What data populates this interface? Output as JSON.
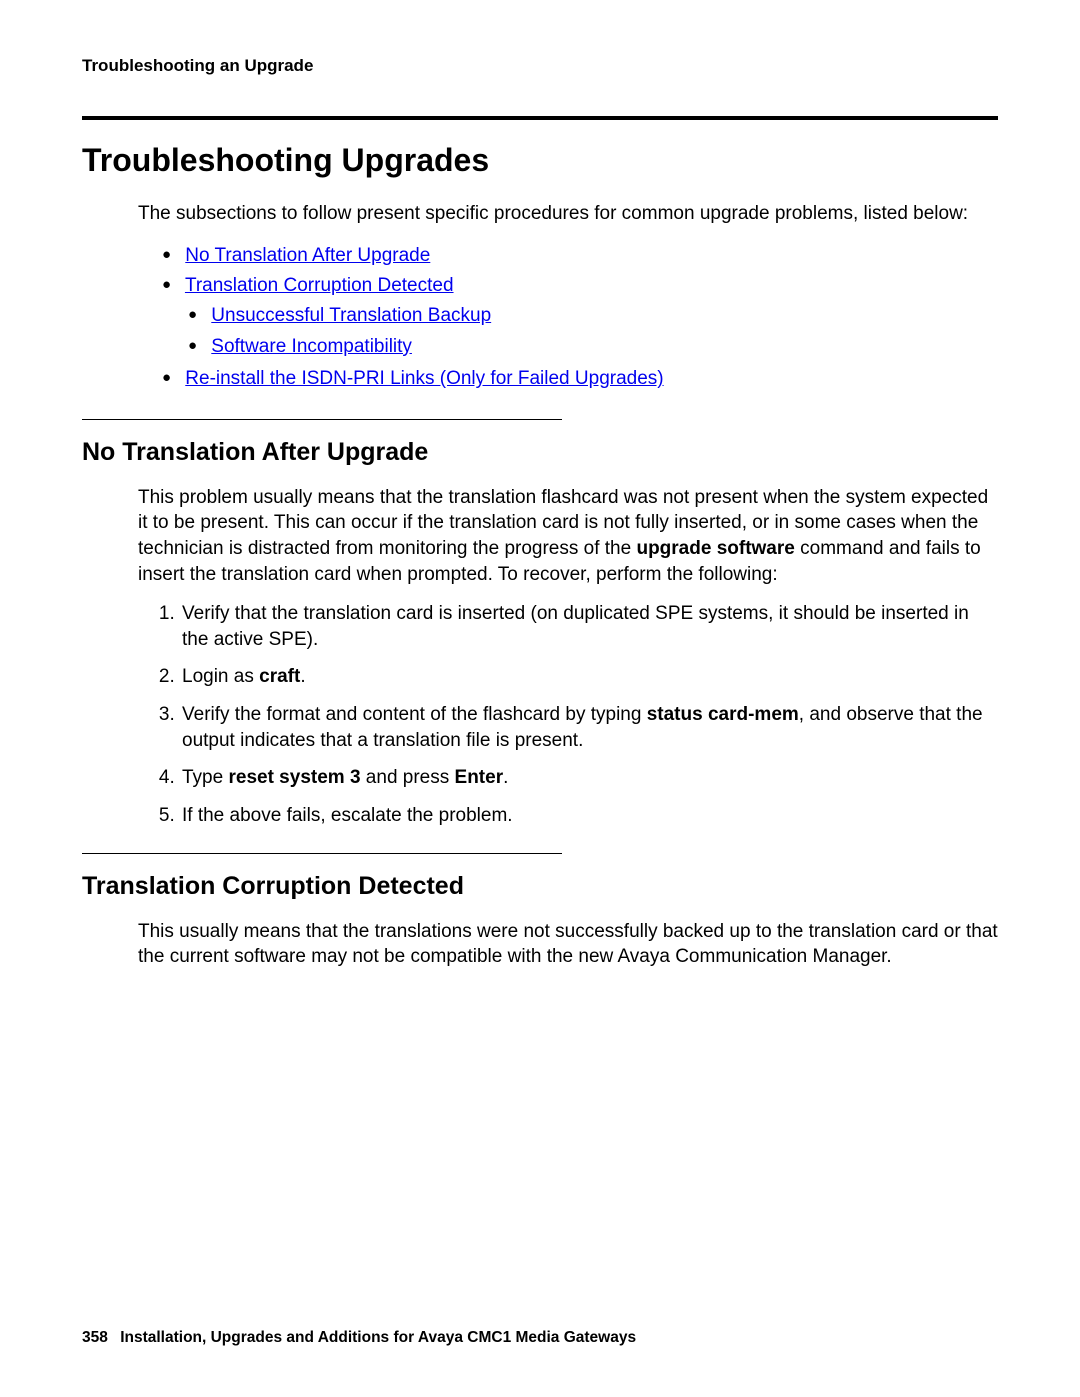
{
  "running_head": "Troubleshooting an Upgrade",
  "h1": "Troubleshooting Upgrades",
  "intro": "The subsections to follow present specific procedures for common upgrade problems, listed below:",
  "links": {
    "l1": "No Translation After Upgrade",
    "l2": "Translation Corruption Detected",
    "l2a": "Unsuccessful Translation Backup",
    "l2b": "Software Incompatibility",
    "l3": "Re-install the ISDN-PRI Links (Only for Failed Upgrades)"
  },
  "sec1": {
    "title": "No Translation After Upgrade",
    "para_pre": "This problem usually means that the translation flashcard was not present when the system expected it to be present. This can occur if the translation card is not fully inserted, or in some cases when the technician is distracted from monitoring the progress of the ",
    "para_bold": "upgrade software",
    "para_post": " command and fails to insert the translation card when prompted. To recover, perform the following:",
    "steps": {
      "s1": "Verify that the translation card is inserted (on duplicated SPE systems, it should be inserted in the active SPE).",
      "s2_pre": "Login as ",
      "s2_bold": "craft",
      "s2_post": ".",
      "s3_pre": "Verify the format and content of the flashcard by typing ",
      "s3_bold": "status card-mem",
      "s3_post": ", and observe that the output indicates that a translation file is present.",
      "s4_pre": "Type ",
      "s4_b1": "reset system 3",
      "s4_mid": " and press ",
      "s4_b2": "Enter",
      "s4_post": ".",
      "s5": "If the above fails, escalate the problem."
    }
  },
  "sec2": {
    "title": "Translation Corruption Detected",
    "para": "This usually means that the translations were not successfully backed up to the translation card or that the current software may not be compatible with the new Avaya Communication Manager."
  },
  "footer": {
    "page": "358",
    "title": "Installation, Upgrades and Additions for Avaya CMC1 Media Gateways"
  }
}
